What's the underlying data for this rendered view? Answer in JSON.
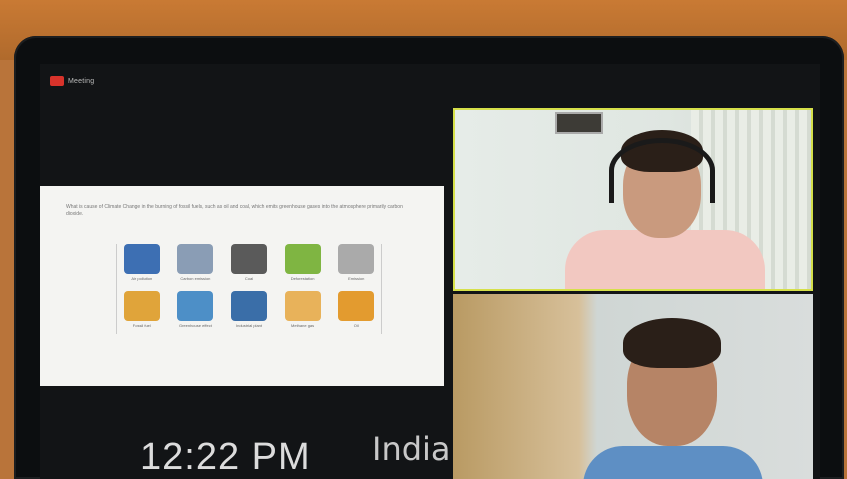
{
  "meeting": {
    "label": "Meeting"
  },
  "slide": {
    "caption": "What is cause of Climate Change in the burning of fossil fuels, such as oil and coal, which emits greenhouse gases into the atmosphere primarily carbon dioxide.",
    "items": [
      {
        "label": "Air pollution",
        "color": "#3d6fb3"
      },
      {
        "label": "Carbon emission",
        "color": "#8a9db5"
      },
      {
        "label": "Coal",
        "color": "#5a5a5a"
      },
      {
        "label": "Deforestation",
        "color": "#7fb542"
      },
      {
        "label": "Emission",
        "color": "#aaaaaa"
      },
      {
        "label": "Fossil fuel",
        "color": "#e0a43a"
      },
      {
        "label": "Greenhouse effect",
        "color": "#4d8fc7"
      },
      {
        "label": "Industrial plant",
        "color": "#3a6ea8"
      },
      {
        "label": "Methane gas",
        "color": "#e8b25a"
      },
      {
        "label": "Oil",
        "color": "#e39b2f"
      }
    ]
  },
  "overlay": {
    "time": "12:22 PM",
    "country": "India"
  }
}
